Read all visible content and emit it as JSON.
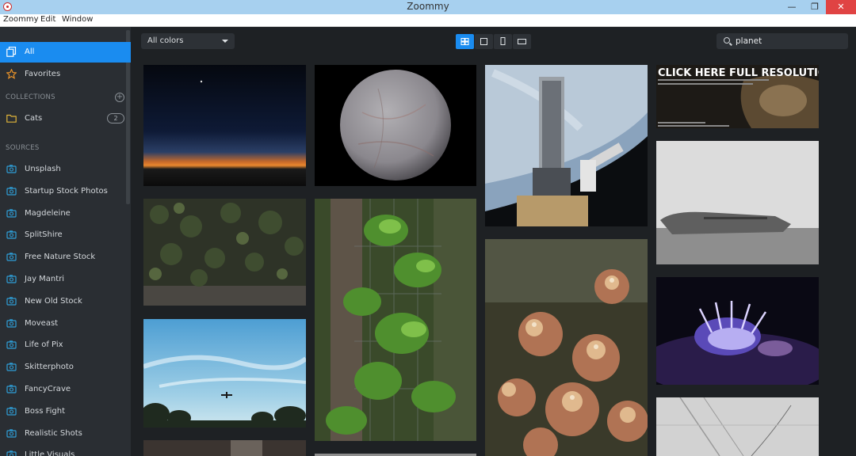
{
  "window": {
    "title": "Zoommy",
    "min_glyph": "—",
    "max_glyph": "❐",
    "close_glyph": "✕"
  },
  "menu": [
    "Zoommy",
    "Edit",
    "Window"
  ],
  "sidebar": {
    "top_items": [
      {
        "label": "All",
        "icon": "copy-icon",
        "active": true
      },
      {
        "label": "Favorites",
        "icon": "star-icon",
        "active": false
      }
    ],
    "collections_header": "COLLECTIONS",
    "collections": [
      {
        "label": "Cats",
        "icon": "folder-icon",
        "count": "2"
      }
    ],
    "sources_header": "SOURCES",
    "sources": [
      "Unsplash",
      "Startup Stock Photos",
      "Magdeleine",
      "SplitShire",
      "Free Nature Stock",
      "Jay Mantri",
      "New Old Stock",
      "Moveast",
      "Life of Pix",
      "Skitterphoto",
      "FancyCrave",
      "Boss Fight",
      "Realistic Shots",
      "Little Visuals"
    ]
  },
  "toolbar": {
    "color_filter": "All colors",
    "search_value": "planet",
    "view_modes": [
      "grid-view-icon",
      "single-view-icon",
      "portrait-view-icon",
      "landscape-view-icon"
    ],
    "active_view": 0
  },
  "gallery": {
    "photos": [
      {
        "name": "photo-night-horizon",
        "icon": "night-sky-sunset"
      },
      {
        "name": "photo-moon",
        "icon": "moon-europa"
      },
      {
        "name": "photo-space-station",
        "icon": "hubble-telescope-earth"
      },
      {
        "name": "photo-full-resolution-banner",
        "icon": "banner",
        "overlay_text": "CLICK HERE FULL RESOLUTION"
      },
      {
        "name": "photo-ivy-wall",
        "icon": "ivy-leaves"
      },
      {
        "name": "photo-green-plant",
        "icon": "green-leaves-fence"
      },
      {
        "name": "photo-plane-wreck",
        "icon": "plane-wreck-fog"
      },
      {
        "name": "photo-succulent",
        "icon": "succulent-closeup"
      },
      {
        "name": "photo-sea-slug",
        "icon": "nudibranch-underwater"
      },
      {
        "name": "photo-airplane-sky",
        "icon": "airplane-blue-sky"
      },
      {
        "name": "photo-concrete",
        "icon": "concrete-floor"
      },
      {
        "name": "photo-partial-bottom",
        "icon": "partial"
      }
    ]
  },
  "colors": {
    "accent": "#1a8cf0",
    "sidebar_bg": "#2a2e33",
    "main_bg": "#1e2124",
    "titlebar": "#a7d0ef",
    "close": "#e04343",
    "favorites_star": "#e8922a",
    "folder": "#e0b43a",
    "source_icon": "#2f9fd8"
  }
}
